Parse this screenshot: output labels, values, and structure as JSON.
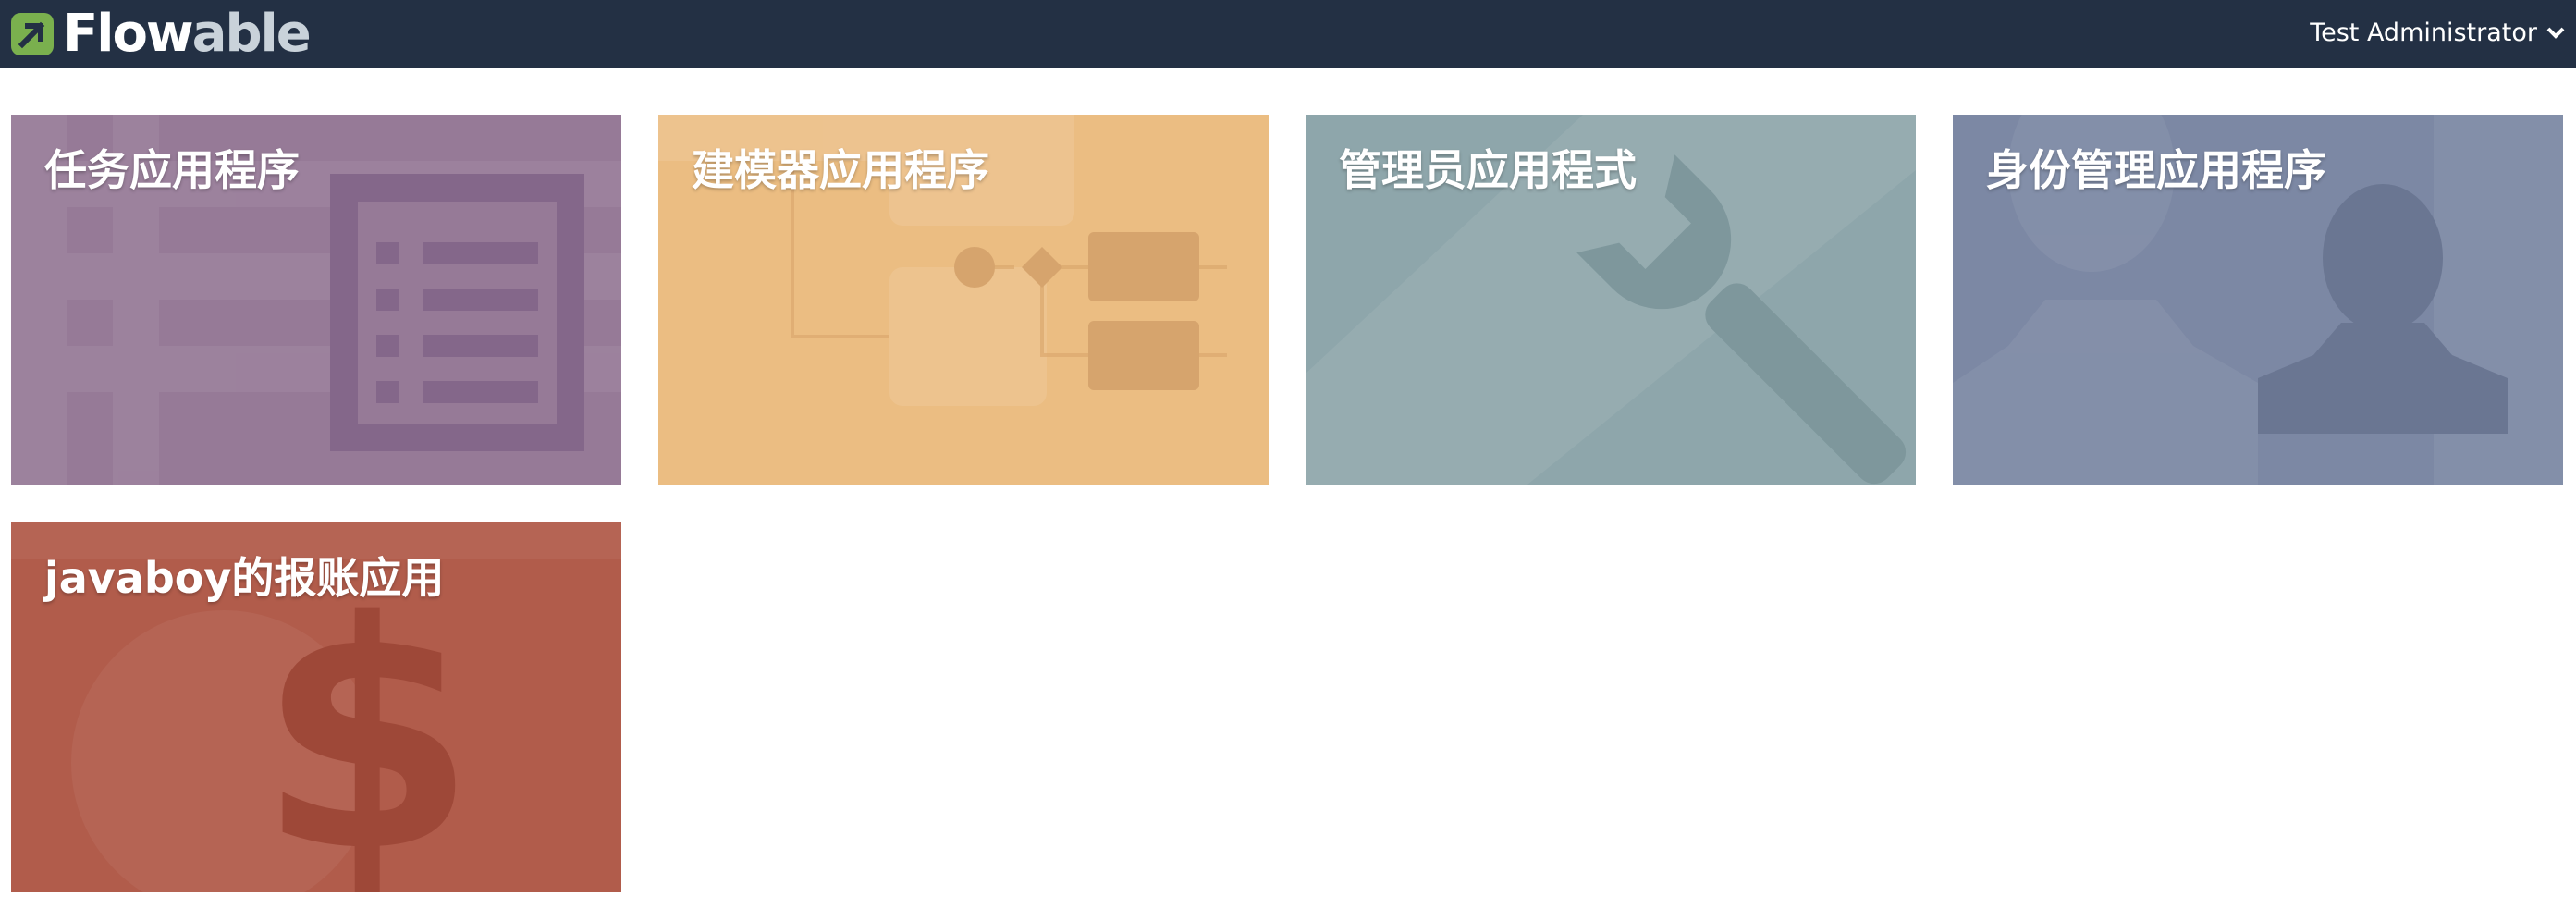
{
  "brand": {
    "name_bold": "Flow",
    "name_dim": "able"
  },
  "user": {
    "name": "Test Administrator"
  },
  "apps": [
    {
      "title": "任务应用程序",
      "color": "#967a97",
      "icon": "task-list-icon"
    },
    {
      "title": "建模器应用程序",
      "color": "#ebbd82",
      "icon": "process-diagram-icon"
    },
    {
      "title": "管理员应用程式",
      "color": "#8ea6ab",
      "icon": "wrench-icon"
    },
    {
      "title": "身份管理应用程序",
      "color": "#7c88a4",
      "icon": "user-silhouette-icon"
    },
    {
      "title": "javaboy的报账应用",
      "color": "#b15c4b",
      "icon": "dollar-icon"
    }
  ]
}
